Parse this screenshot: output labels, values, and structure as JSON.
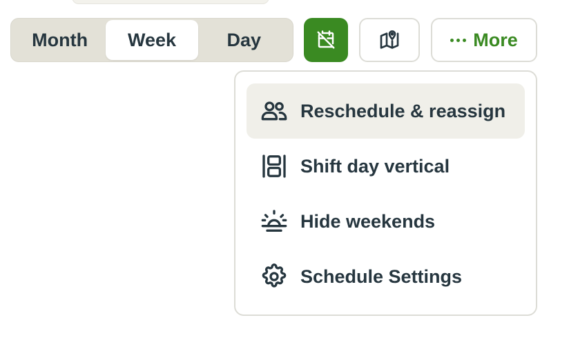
{
  "view_switcher": {
    "options": [
      {
        "label": "Month",
        "active": false
      },
      {
        "label": "Week",
        "active": true
      },
      {
        "label": "Day",
        "active": false
      }
    ]
  },
  "toolbar": {
    "calendar_icon": "calendar-off-icon",
    "map_icon": "map-pin-icon",
    "more_label": "More",
    "accent_color": "#3a8a22"
  },
  "more_menu": {
    "items": [
      {
        "label": "Reschedule & reassign",
        "icon": "users-icon",
        "highlighted": true
      },
      {
        "label": "Shift day vertical",
        "icon": "layout-columns-icon",
        "highlighted": false
      },
      {
        "label": "Hide weekends",
        "icon": "sunrise-icon",
        "highlighted": false
      },
      {
        "label": "Schedule Settings",
        "icon": "gear-icon",
        "highlighted": false
      }
    ]
  }
}
